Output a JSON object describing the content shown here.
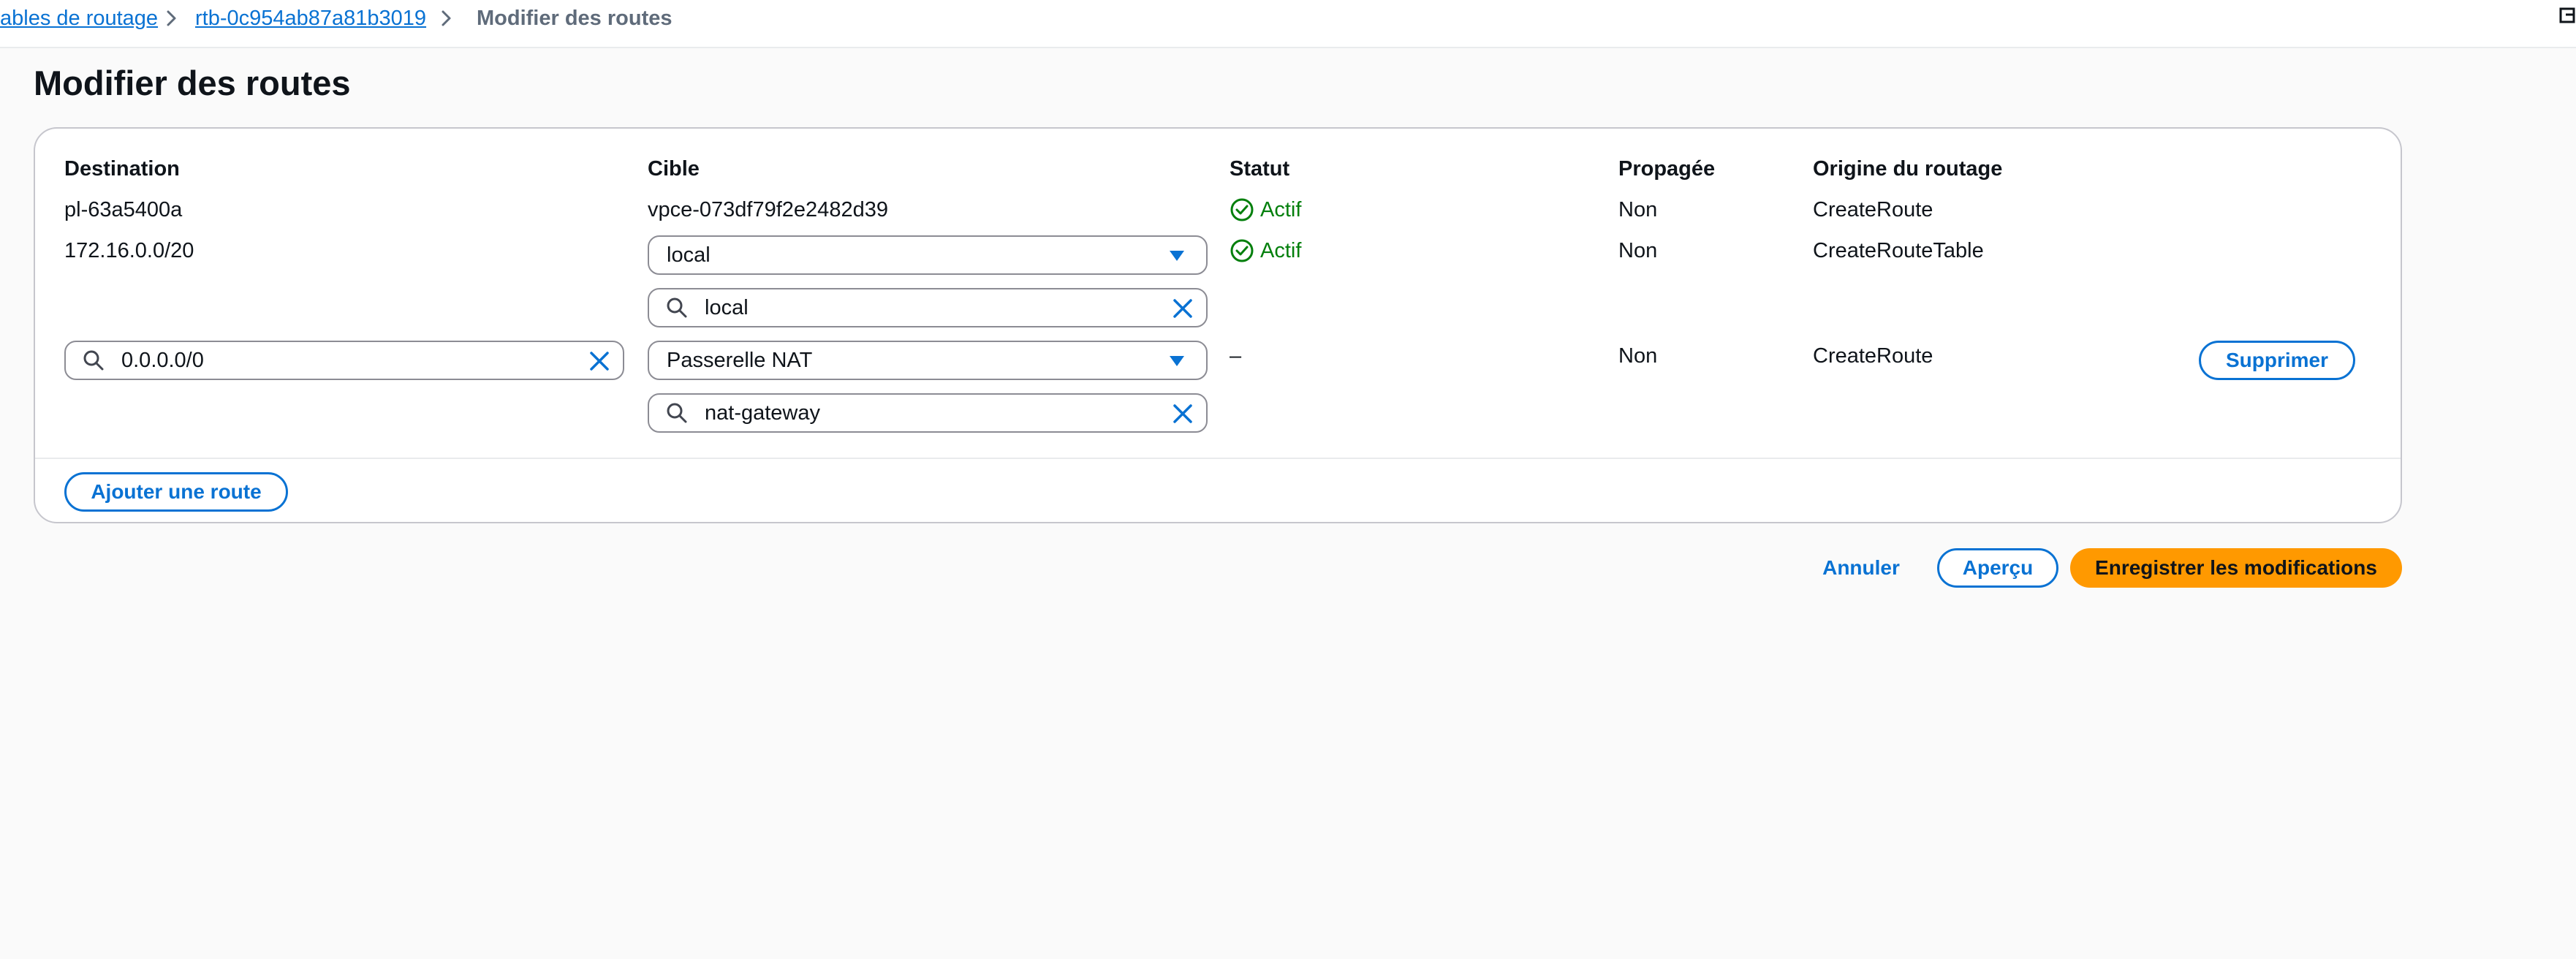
{
  "breadcrumb": {
    "items": [
      {
        "label": "ables de routage"
      },
      {
        "label": "rtb-0c954ab87a81b3019"
      }
    ],
    "current": "Modifier des routes"
  },
  "page": {
    "title": "Modifier des routes"
  },
  "table": {
    "headers": {
      "destination": "Destination",
      "target": "Cible",
      "status": "Statut",
      "propagated": "Propagée",
      "origin": "Origine du routage"
    },
    "rows": [
      {
        "destination": "pl-63a5400a",
        "target": "vpce-073df79f2e2482d39",
        "status": "Actif",
        "propagated": "Non",
        "origin": "CreateRoute"
      },
      {
        "destination": "172.16.0.0/20",
        "target_select": "local",
        "target_search": "local",
        "status": "Actif",
        "propagated": "Non",
        "origin": "CreateRouteTable"
      },
      {
        "destination_input": "0.0.0.0/0",
        "target_select": "Passerelle NAT",
        "target_search": "nat-gateway",
        "status": "–",
        "propagated": "Non",
        "origin": "CreateRoute",
        "remove_label": "Supprimer"
      }
    ]
  },
  "actions": {
    "add_route": "Ajouter une route",
    "cancel": "Annuler",
    "preview": "Aperçu",
    "save": "Enregistrer les modifications"
  },
  "colors": {
    "link": "#0972d3",
    "success": "#037f0c",
    "primary": "#ff9900"
  },
  "icons": [
    "chevron-right-icon",
    "check-circle-icon",
    "search-icon",
    "clear-icon",
    "caret-down-icon",
    "external-icon"
  ]
}
